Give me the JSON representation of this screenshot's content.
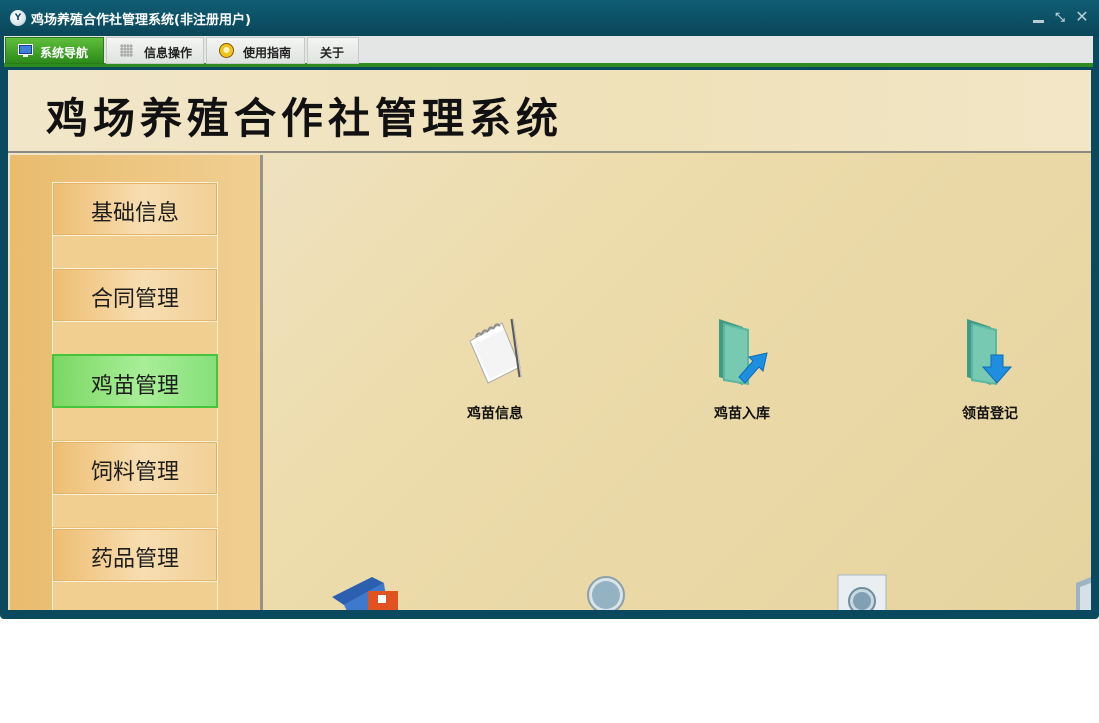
{
  "window": {
    "title": "鸡场养殖合作社管理系统(非注册用户)",
    "app_icon_text": "Y",
    "controls": {
      "restore": "⤡",
      "close": "✕"
    }
  },
  "tabs": [
    {
      "label": "系统导航",
      "active": true,
      "icon": "monitor-icon"
    },
    {
      "label": "信息操作",
      "active": false,
      "icon": "grid-icon"
    },
    {
      "label": "使用指南",
      "active": false,
      "icon": "lightbulb-icon"
    },
    {
      "label": "关于",
      "active": false,
      "icon": null
    }
  ],
  "banner": {
    "title": "鸡场养殖合作社管理系统"
  },
  "sidebar": {
    "items": [
      {
        "label": "基础信息",
        "active": false
      },
      {
        "label": "合同管理",
        "active": false
      },
      {
        "label": "鸡苗管理",
        "active": true
      },
      {
        "label": "饲料管理",
        "active": false
      },
      {
        "label": "药品管理",
        "active": false
      }
    ]
  },
  "content": {
    "tiles": [
      {
        "label": "鸡苗信息",
        "icon": "notepad-icon"
      },
      {
        "label": "鸡苗入库",
        "icon": "folder-arrow-in-icon"
      },
      {
        "label": "领苗登记",
        "icon": "folder-download-icon"
      }
    ],
    "partial_icons": [
      "book-icon",
      "magnifier-icon",
      "search-document-icon",
      "folder-icon"
    ]
  },
  "colors": {
    "titlebar": "#0b4a5e",
    "active_tab": "#3a9a24",
    "sidebar": "#ebc27c",
    "active_sidebar_item": "#8fe27e",
    "canvas": "#ecdcae"
  }
}
